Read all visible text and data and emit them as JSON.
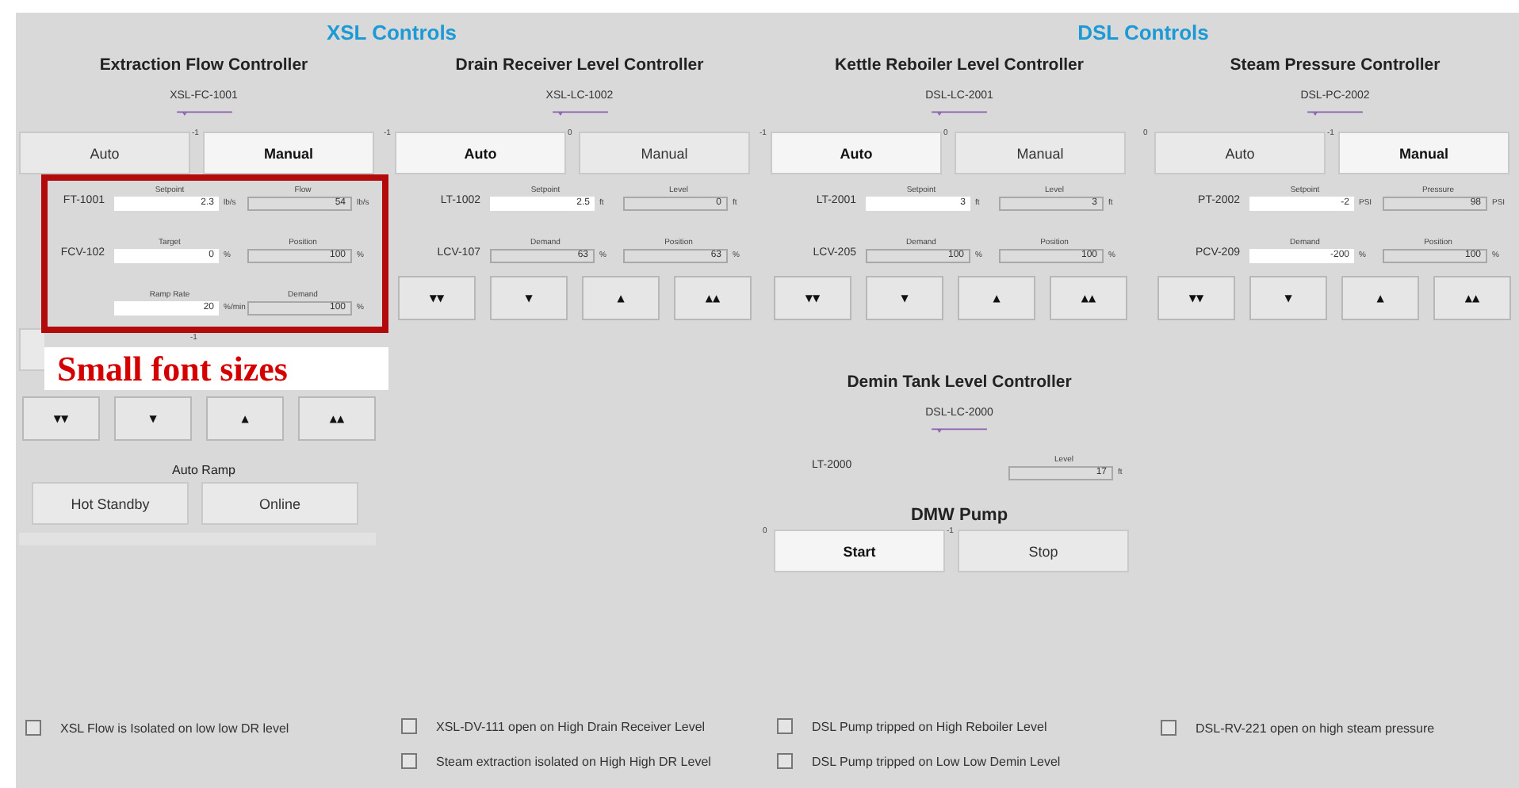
{
  "sections": [
    {
      "title": "XSL Controls"
    },
    {
      "title": "DSL Controls"
    }
  ],
  "columns": [
    {
      "controller": {
        "title": "Extraction Flow Controller",
        "tag": "XSL-FC-1001",
        "modes": [
          {
            "label": "Auto",
            "selected": false
          },
          {
            "label": "Manual",
            "selected": true,
            "badge": "-1"
          }
        ],
        "rows": [
          {
            "tag": "FT-1001",
            "fields": [
              {
                "label": "Setpoint",
                "value": "2.3",
                "unit": "lb/s",
                "editable": true
              },
              {
                "label": "Flow",
                "value": "54",
                "unit": "lb/s",
                "editable": false
              }
            ]
          },
          {
            "tag": "FCV-102",
            "fields": [
              {
                "label": "Target",
                "value": "0",
                "unit": "%",
                "editable": true
              },
              {
                "label": "Position",
                "value": "100",
                "unit": "%",
                "editable": false
              }
            ]
          },
          {
            "fields": [
              {
                "label": "Ramp Rate",
                "value": "20",
                "unit": "%/min",
                "editable": true
              },
              {
                "label": "Demand",
                "value": "100",
                "unit": "%",
                "editable": false
              }
            ]
          }
        ],
        "covered_buttons": {
          "badge": "-1"
        },
        "jog": [
          "▼▼",
          "▼",
          "▲",
          "▲▲"
        ]
      },
      "auto_ramp": {
        "title": "Auto Ramp",
        "buttons": [
          "Hot Standby",
          "Online"
        ]
      },
      "interlocks": [
        {
          "label": "XSL Flow is Isolated on low low DR level",
          "checked": false
        }
      ]
    },
    {
      "controller": {
        "title": "Drain Receiver Level Controller",
        "tag": "XSL-LC-1002",
        "modes": [
          {
            "label": "Auto",
            "selected": true,
            "badge": "-1"
          },
          {
            "label": "Manual",
            "selected": false,
            "badge": "0"
          }
        ],
        "rows": [
          {
            "tag": "LT-1002",
            "fields": [
              {
                "label": "Setpoint",
                "value": "2.5",
                "unit": "ft",
                "editable": true
              },
              {
                "label": "Level",
                "value": "0",
                "unit": "ft",
                "editable": false
              }
            ]
          },
          {
            "tag": "LCV-107",
            "fields": [
              {
                "label": "Demand",
                "value": "63",
                "unit": "%",
                "editable": false
              },
              {
                "label": "Position",
                "value": "63",
                "unit": "%",
                "editable": false
              }
            ]
          }
        ],
        "jog": [
          "▼▼",
          "▼",
          "▲",
          "▲▲"
        ]
      },
      "interlocks": [
        {
          "label": "XSL-DV-111 open on High Drain Receiver Level",
          "checked": false
        },
        {
          "label": "Steam extraction isolated on High High DR Level",
          "checked": false
        }
      ]
    },
    {
      "controller": {
        "title": "Kettle Reboiler Level Controller",
        "tag": "DSL-LC-2001",
        "modes": [
          {
            "label": "Auto",
            "selected": true,
            "badge": "-1"
          },
          {
            "label": "Manual",
            "selected": false,
            "badge": "0"
          }
        ],
        "rows": [
          {
            "tag": "LT-2001",
            "fields": [
              {
                "label": "Setpoint",
                "value": "3",
                "unit": "ft",
                "editable": true
              },
              {
                "label": "Level",
                "value": "3",
                "unit": "ft",
                "editable": false
              }
            ]
          },
          {
            "tag": "LCV-205",
            "fields": [
              {
                "label": "Demand",
                "value": "100",
                "unit": "%",
                "editable": false
              },
              {
                "label": "Position",
                "value": "100",
                "unit": "%",
                "editable": false
              }
            ]
          }
        ],
        "jog": [
          "▼▼",
          "▼",
          "▲",
          "▲▲"
        ]
      },
      "demin": {
        "title": "Demin Tank Level Controller",
        "tag": "DSL-LC-2000",
        "row": {
          "tag": "LT-2000",
          "field": {
            "label": "Level",
            "value": "17",
            "unit": "ft",
            "editable": false
          }
        }
      },
      "pump": {
        "title": "DMW Pump",
        "buttons": [
          {
            "label": "Start",
            "selected": true,
            "badge": "0"
          },
          {
            "label": "Stop",
            "selected": false,
            "badge": "-1"
          }
        ]
      },
      "interlocks": [
        {
          "label": "DSL Pump tripped on High Reboiler Level",
          "checked": false
        },
        {
          "label": "DSL Pump tripped on Low Low Demin Level",
          "checked": false
        }
      ]
    },
    {
      "controller": {
        "title": "Steam Pressure Controller",
        "tag": "DSL-PC-2002",
        "modes": [
          {
            "label": "Auto",
            "selected": false,
            "badge": "0"
          },
          {
            "label": "Manual",
            "selected": true,
            "badge": "-1"
          }
        ],
        "rows": [
          {
            "tag": "PT-2002",
            "fields": [
              {
                "label": "Setpoint",
                "value": "-2",
                "unit": "PSI",
                "editable": true
              },
              {
                "label": "Pressure",
                "value": "98",
                "unit": "PSI",
                "editable": false
              }
            ]
          },
          {
            "tag": "PCV-209",
            "fields": [
              {
                "label": "Demand",
                "value": "-200",
                "unit": "%",
                "editable": true
              },
              {
                "label": "Position",
                "value": "100",
                "unit": "%",
                "editable": false
              }
            ]
          }
        ],
        "jog": [
          "▼▼",
          "▼",
          "▲",
          "▲▲"
        ]
      },
      "interlocks": [
        {
          "label": "DSL-RV-221 open on high steam pressure",
          "checked": false
        }
      ]
    }
  ],
  "annotation": {
    "text": "Small font sizes"
  }
}
